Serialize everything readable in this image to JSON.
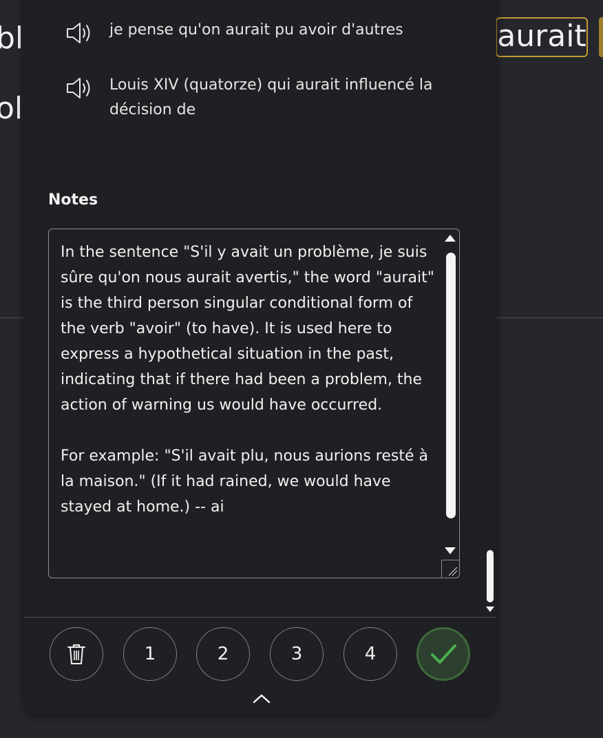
{
  "background": {
    "fragment_line1": "bl",
    "fragment_line2": "ol",
    "highlighted_word": "aurait"
  },
  "examples": [
    {
      "text": "je pense qu'on aurait pu avoir d'autres",
      "icon": "speaker-icon"
    },
    {
      "text": "Louis XIV (quatorze) qui aurait influencé la décision de",
      "icon": "speaker-icon"
    }
  ],
  "notes": {
    "label": "Notes",
    "text": "In the sentence \"S'il y avait un problème, je suis sûre qu'on nous aurait avertis,\" the word \"aurait\" is the third person singular conditional form of the verb \"avoir\" (to have). It is used here to express a hypothetical situation in the past, indicating that if there had been a problem, the action of warning us would have occurred.\n\nFor example: \"S'il avait plu, nous aurions resté à la maison.\" (If it had rained, we would have stayed at home.) -- ai"
  },
  "footer": {
    "buttons": [
      {
        "label": "",
        "icon": "trash-icon"
      },
      {
        "label": "1"
      },
      {
        "label": "2"
      },
      {
        "label": "3"
      },
      {
        "label": "4"
      },
      {
        "label": "",
        "icon": "checkmark-icon"
      }
    ],
    "collapse_icon": "chevron-up-icon"
  },
  "colors": {
    "highlight_border": "#c29a33",
    "confirm_green": "#4caf50",
    "confirm_border": "#3f6a3d"
  }
}
